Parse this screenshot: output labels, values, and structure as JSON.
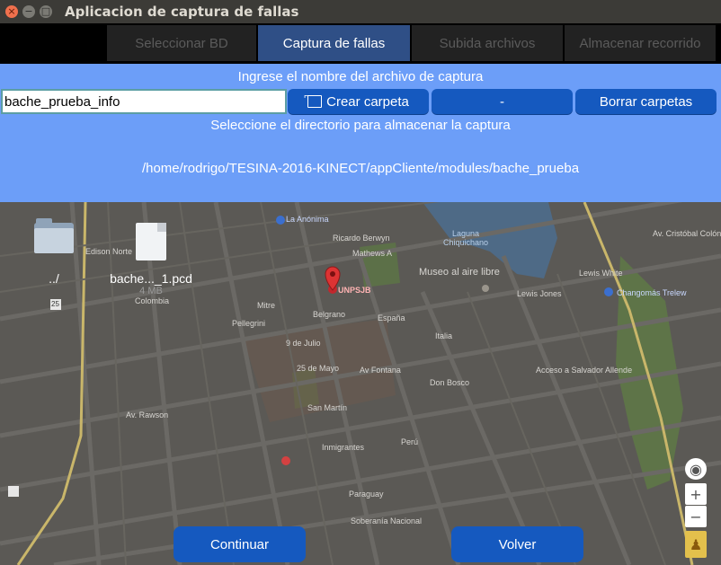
{
  "window": {
    "title": "Aplicacion de captura de fallas"
  },
  "tabs": [
    {
      "label": "Seleccionar BD",
      "active": false
    },
    {
      "label": "Captura de fallas",
      "active": true
    },
    {
      "label": "Subida archivos",
      "active": false
    },
    {
      "label": "Almacenar recorrido",
      "active": false
    }
  ],
  "form": {
    "prompt_name": "Ingrese el nombre del archivo de captura",
    "filename_value": "bache_prueba_info",
    "create_folder_label": "Crear carpeta",
    "middle_label": "-",
    "delete_folders_label": "Borrar carpetas",
    "prompt_dir": "Seleccione el directorio para almacenar la captura",
    "current_path": "/home/rodrigo/TESINA-2016-KINECT/appCliente/modules/bache_prueba"
  },
  "files": [
    {
      "name": "../",
      "size": ""
    },
    {
      "name": "bache..._1.pcd",
      "size": "4 MB"
    }
  ],
  "map": {
    "labels": {
      "la_anonima": "La Anónima",
      "unpsjb": "UNPSJB",
      "museo": "Museo al aire libre",
      "laguna": "Laguna Chiquichano",
      "changomas": "Changomás Trelew",
      "lewis_jones": "Lewis Jones",
      "don_bosco": "Don Bosco",
      "acceso": "Acceso a Salvador Allende",
      "ricardo_berwyn": "Ricardo Berwyn",
      "mathews": "Mathews A",
      "belgrano": "Belgrano",
      "espana": "España",
      "italia": "Italia",
      "9_de_julio": "9 de Julio",
      "25_de_mayo": "25 de Mayo",
      "san_martin": "San Martín",
      "fontana": "Av Fontana",
      "rawson": "Av. Rawson",
      "inmigrantes": "Inmigrantes",
      "paraguay": "Paraguay",
      "peru": "Perú",
      "soberania": "Soberanía Nacional",
      "edison": "Edison Norte",
      "colombia": "Colombia",
      "mitre": "Mitre",
      "pellegrini": "Pellegrini",
      "lewis_white": "Lewis White",
      "cristobal_colon": "Av. Cristóbal Colón"
    },
    "route_number": "25"
  },
  "buttons": {
    "continue": "Continuar",
    "back": "Volver"
  },
  "colors": {
    "accent": "#1559bf",
    "panel": "#6c9ef8",
    "active_tab": "#2f4f86"
  }
}
